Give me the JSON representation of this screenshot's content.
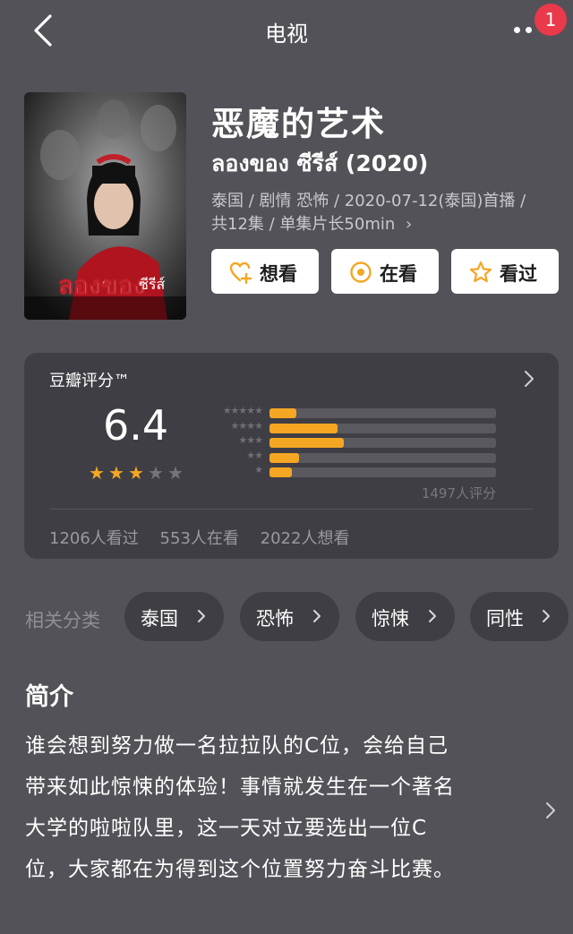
{
  "header": {
    "title": "电视",
    "badge_count": "1"
  },
  "subject": {
    "title_cn": "恶魔的艺术",
    "title_original": "ลองของ ซีรีส์ (2020)",
    "meta_line1": "泰国 / 剧情 恐怖 / 2020-07-12(泰国)首播 /",
    "meta_line2": "共12集 / 单集片长50min",
    "meta_chevron": "›"
  },
  "actions": [
    {
      "label": "想看",
      "icon": "heart-plus-icon"
    },
    {
      "label": "在看",
      "icon": "target-icon"
    },
    {
      "label": "看过",
      "icon": "star-outline-icon"
    }
  ],
  "rating": {
    "heading": "豆瓣评分™",
    "score": "6.4",
    "score_value": 6.4,
    "stars_filled": 3,
    "stars_total": 5,
    "distribution": [
      {
        "stars": "★★★★★",
        "fraction": 0.12
      },
      {
        "stars": "★★★★",
        "fraction": 0.3
      },
      {
        "stars": "★★★",
        "fraction": 0.33
      },
      {
        "stars": "★★",
        "fraction": 0.13
      },
      {
        "stars": "★",
        "fraction": 0.1
      }
    ],
    "count": "1497人评分",
    "watched": "1206人看过",
    "watching": "553人在看",
    "wish": "2022人想看",
    "colors": {
      "accent": "#f5a623",
      "track": "#5a595f"
    }
  },
  "tags": {
    "label": "相关分类",
    "items": [
      "泰国",
      "恐怖",
      "惊悚",
      "同性"
    ]
  },
  "synopsis": {
    "title": "简介",
    "lines": [
      "谁会想到努力做一名拉拉队的C位，会给自己",
      "带来如此惊悚的体验！事情就发生在一个著名",
      "大学的啦啦队里，这一天对立要选出一位C",
      "位，大家都在为得到这个位置努力奋斗比赛。"
    ]
  }
}
